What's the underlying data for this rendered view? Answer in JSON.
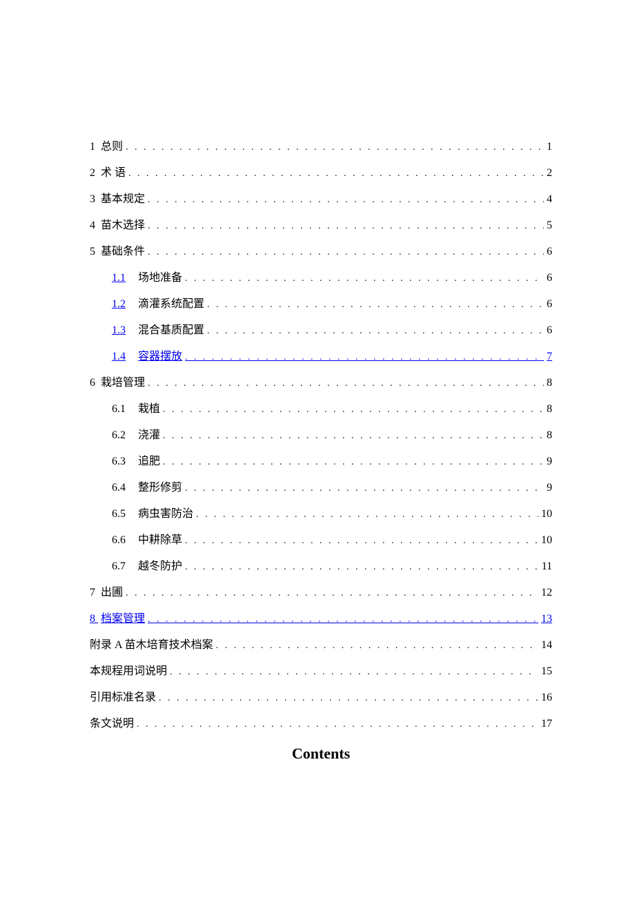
{
  "toc": [
    {
      "level": 1,
      "number": "1",
      "title": "总则",
      "page": "1",
      "link": false,
      "gap": true
    },
    {
      "level": 1,
      "number": "2",
      "title": "术 语",
      "page": "2",
      "link": false,
      "gap": false
    },
    {
      "level": 1,
      "number": "3",
      "title": "基本规定",
      "page": "4",
      "link": false,
      "gap": false
    },
    {
      "level": 1,
      "number": "4",
      "title": "苗木选择",
      "page": "5",
      "link": false,
      "gap": false
    },
    {
      "level": 1,
      "number": "5",
      "title": "基础条件",
      "page": "6",
      "link": false,
      "gap": false
    },
    {
      "level": 2,
      "number": "1.1",
      "title": "场地准备",
      "page": "6",
      "link": false,
      "linkNumber": true
    },
    {
      "level": 2,
      "number": "1.2",
      "title": "滴灌系统配置",
      "page": "6",
      "link": false,
      "linkNumber": true
    },
    {
      "level": 2,
      "number": "1.3",
      "title": "混合基质配置",
      "page": "6",
      "link": false,
      "linkNumber": true
    },
    {
      "level": 2,
      "number": "1.4",
      "title": "容器摆放",
      "page": "7",
      "link": true,
      "linkNumber": true
    },
    {
      "level": 1,
      "number": "6",
      "title": "栽培管理",
      "page": "8",
      "link": false,
      "gap": false
    },
    {
      "level": 2,
      "number": "6.1",
      "title": "栽植",
      "page": "8",
      "link": false
    },
    {
      "level": 2,
      "number": "6.2",
      "title": "浇灌",
      "page": "8",
      "link": false
    },
    {
      "level": 2,
      "number": "6.3",
      "title": "追肥",
      "page": "9",
      "link": false
    },
    {
      "level": 2,
      "number": "6.4",
      "title": "整形修剪",
      "page": "9",
      "link": false
    },
    {
      "level": 2,
      "number": "6.5",
      "title": "病虫害防治",
      "page": "10",
      "link": false
    },
    {
      "level": 2,
      "number": "6.6",
      "title": "中耕除草",
      "page": "10",
      "link": false
    },
    {
      "level": 2,
      "number": "6.7",
      "title": "越冬防护",
      "page": "11",
      "link": false
    },
    {
      "level": 1,
      "number": "7",
      "title": "出圃",
      "page": "12",
      "link": false,
      "gap": true
    },
    {
      "level": 1,
      "number": "8",
      "title": "档案管理",
      "page": "13",
      "link": true,
      "gap": false
    },
    {
      "level": 1,
      "number": "",
      "title": "附录 A 苗木培育技术档案",
      "page": "14",
      "link": false
    },
    {
      "level": 1,
      "number": "",
      "title": "本规程用词说明",
      "page": "15",
      "link": false
    },
    {
      "level": 1,
      "number": "",
      "title": "引用标准名录",
      "page": "16",
      "link": false
    },
    {
      "level": 1,
      "number": "",
      "title": "条文说明",
      "page": "17",
      "link": false
    }
  ],
  "heading": "Contents"
}
